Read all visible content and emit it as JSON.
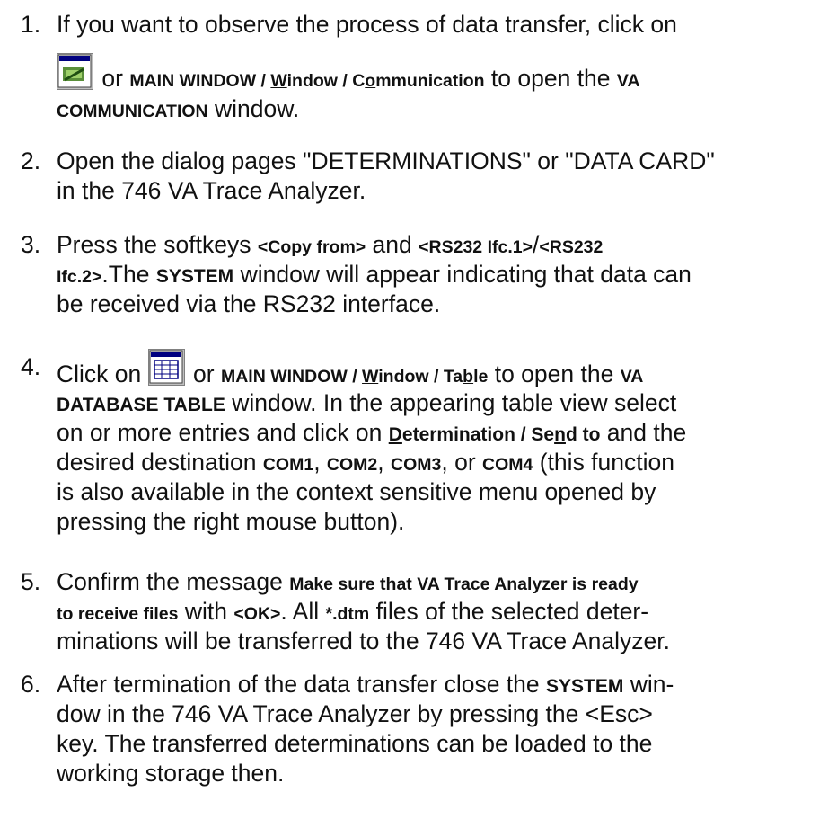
{
  "steps": [
    {
      "number": "1.",
      "line1": "If you want to observe the process of data transfer, click on",
      "icon": "communication-window-icon",
      "or": "or",
      "path_a": "MAIN WINDOW / ",
      "path_w": "W",
      "path_b": "indow / C",
      "path_o": "o",
      "path_c": "mmunication",
      "to_open": "to open the",
      "va": "VA",
      "line3_bold": "COMMUNICATION",
      "line3_text": "window."
    },
    {
      "number": "2.",
      "line1": "Open the dialog pages \"DETERMINATIONS\" or \"DATA CARD\"",
      "line2": "in the 746 VA Trace Analyzer."
    },
    {
      "number": "3.",
      "press": "Press the softkeys",
      "key1": "<Copy from>",
      "and": "and",
      "key2": "<RS232 Ifc.1>",
      "slash": "/",
      "key3a": "<RS232",
      "key3b": "Ifc.2>",
      "the": ".The",
      "system": "SYSTEM",
      "line2_rest": "window will appear indicating that data can",
      "line3": "be received via the RS232 interface."
    },
    {
      "number": "4.",
      "click_on": "Click on",
      "icon": "table-window-icon",
      "or": "or",
      "path_a": "MAIN WINDOW / ",
      "path_w": "W",
      "path_b": "indow / Ta",
      "path_bl": "b",
      "path_c": "le",
      "to_open": "to open the",
      "va": "VA",
      "db_table": "DATABASE TABLE",
      "line2_rest": "window. In the appearing table view select",
      "line3_a": "on or more entries and click on",
      "det_d": "D",
      "det_rest": "etermination / Se",
      "det_n": "n",
      "det_end": "d to",
      "line3_b": "and the",
      "line4_a": "desired destination",
      "com1": "COM1",
      "com2": "COM2",
      "com3": "COM3",
      "or2": "or",
      "com4": "COM4",
      "line4_b": "(this function",
      "line5": "is also available in the context sensitive menu opened by",
      "line6": "pressing the right mouse button)."
    },
    {
      "number": "5.",
      "confirm": "Confirm the message",
      "msg_a": "Make sure that VA Trace Analyzer is ready",
      "msg_b": "to receive files",
      "with": "with",
      "ok": "<OK>",
      "all": ". All",
      "dtm": "*.dtm",
      "line2_rest": "files of the selected deter-",
      "line3": "minations will be transferred to the 746 VA Trace Analyzer."
    },
    {
      "number": "6.",
      "line1_a": "After termination of the data transfer close the",
      "system": "SYSTEM",
      "line1_b": "win-",
      "line2": "dow in the 746 VA Trace Analyzer by pressing the <Esc>",
      "line3": "key. The transferred determinations can be loaded to the",
      "line4": "working storage then."
    }
  ]
}
